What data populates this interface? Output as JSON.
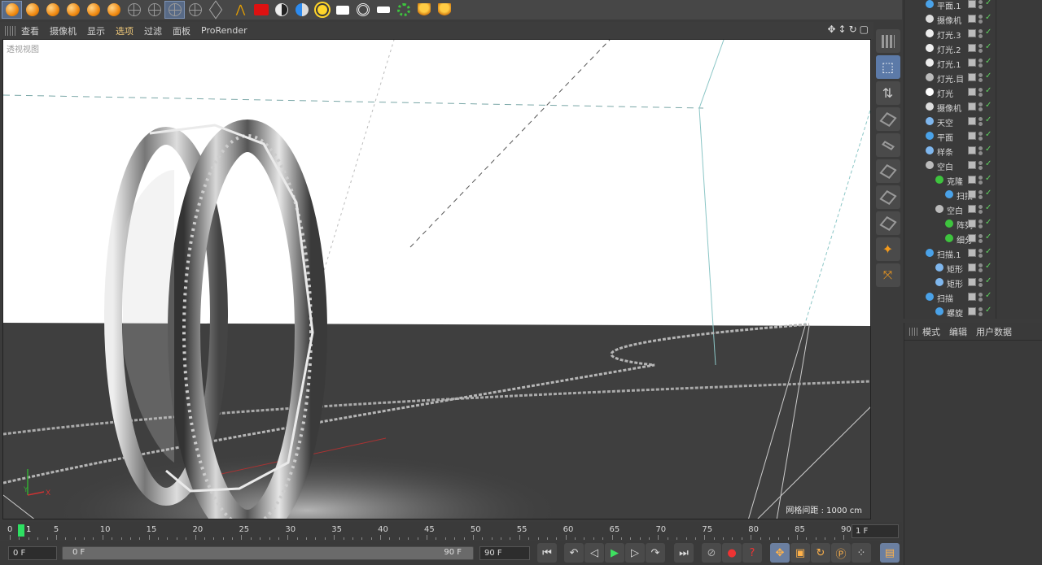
{
  "viewport_menu": {
    "items": [
      "查看",
      "摄像机",
      "显示",
      "选项",
      "过滤",
      "面板",
      "ProRender"
    ],
    "selected": "选项"
  },
  "viewport": {
    "label": "透视视图",
    "grid_spacing": "网格间距 : 1000 cm"
  },
  "objects": [
    {
      "name": "平面.1",
      "icon": "plane-icon"
    },
    {
      "name": "摄像机",
      "icon": "camera-icon"
    },
    {
      "name": "灯光.3",
      "icon": "light-icon"
    },
    {
      "name": "灯光.2",
      "icon": "light-icon"
    },
    {
      "name": "灯光.1",
      "icon": "light-icon"
    },
    {
      "name": "灯光.目",
      "icon": "null-icon"
    },
    {
      "name": "灯光",
      "icon": "area-light-icon"
    },
    {
      "name": "摄像机",
      "icon": "camera-icon"
    },
    {
      "name": "天空",
      "icon": "sky-icon"
    },
    {
      "name": "平面",
      "icon": "plane-icon"
    },
    {
      "name": "样条",
      "icon": "spline-icon"
    },
    {
      "name": "空白",
      "icon": "null-icon"
    },
    {
      "name": "克隆",
      "icon": "cloner-icon"
    },
    {
      "name": "扫描",
      "icon": "sweep-icon"
    },
    {
      "name": "空白",
      "icon": "null-icon"
    },
    {
      "name": "阵列",
      "icon": "array-icon"
    },
    {
      "name": "细分",
      "icon": "subdivision-icon"
    },
    {
      "name": "扫描.1",
      "icon": "sweep-icon"
    },
    {
      "name": "矩形",
      "icon": "spline-icon"
    },
    {
      "name": "矩形",
      "icon": "spline-icon"
    },
    {
      "name": "扫描",
      "icon": "sweep-icon"
    },
    {
      "name": "螺旋",
      "icon": "helix-icon"
    }
  ],
  "attributes": {
    "tabs": [
      "模式",
      "编辑",
      "用户数据"
    ]
  },
  "timeline": {
    "ticks": [
      "0",
      "5",
      "10",
      "15",
      "20",
      "25",
      "30",
      "35",
      "40",
      "45",
      "50",
      "55",
      "60",
      "65",
      "70",
      "75",
      "80",
      "85",
      "90"
    ],
    "current_frame": "1",
    "end_frame_display": "1 F"
  },
  "transport": {
    "start_field": "0 F",
    "range_start": "0 F",
    "range_end": "90 F",
    "end_field": "90 F"
  }
}
